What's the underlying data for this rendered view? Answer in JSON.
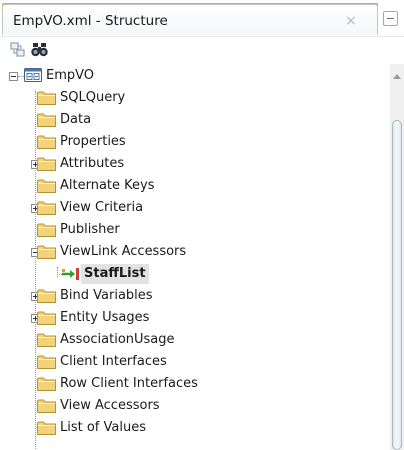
{
  "window": {
    "tab_title": "EmpVO.xml - Structure",
    "close_glyph": "×",
    "minimize_icon": "minimize-icon"
  },
  "toolbar": {
    "buttons": [
      {
        "icon": "sync-selection-icon"
      },
      {
        "icon": "binoculars-find-icon"
      }
    ]
  },
  "tree": {
    "root": {
      "label": "EmpVO",
      "icon": "view-object-icon",
      "expanded": true
    },
    "items": [
      {
        "label": "SQLQuery",
        "icon": "folder-icon",
        "expander": "none"
      },
      {
        "label": "Data",
        "icon": "folder-icon",
        "expander": "none"
      },
      {
        "label": "Properties",
        "icon": "folder-icon",
        "expander": "none"
      },
      {
        "label": "Attributes",
        "icon": "folder-icon",
        "expander": "collapsed"
      },
      {
        "label": "Alternate Keys",
        "icon": "folder-icon",
        "expander": "none"
      },
      {
        "label": "View Criteria",
        "icon": "folder-icon",
        "expander": "collapsed"
      },
      {
        "label": "Publisher",
        "icon": "folder-icon",
        "expander": "none"
      },
      {
        "label": "ViewLink Accessors",
        "icon": "folder-icon",
        "expander": "expanded"
      },
      {
        "label": "StaffList",
        "icon": "viewlink-accessor-icon",
        "expander": "none",
        "child": true,
        "selected": true
      },
      {
        "label": "Bind Variables",
        "icon": "folder-icon",
        "expander": "collapsed"
      },
      {
        "label": "Entity Usages",
        "icon": "folder-icon",
        "expander": "collapsed"
      },
      {
        "label": "AssociationUsage",
        "icon": "folder-icon",
        "expander": "none"
      },
      {
        "label": "Client Interfaces",
        "icon": "folder-icon",
        "expander": "none"
      },
      {
        "label": "Row Client Interfaces",
        "icon": "folder-icon",
        "expander": "none"
      },
      {
        "label": "View Accessors",
        "icon": "folder-icon",
        "expander": "none"
      },
      {
        "label": "List of Values",
        "icon": "folder-icon",
        "expander": "none"
      }
    ]
  },
  "colors": {
    "tab_accent": "#f0a030",
    "folder_fill": "#f2d27a",
    "folder_edge": "#b8922e",
    "selection_bg": "#e2e2e2",
    "accessor_arrow": "#2e9e2e"
  }
}
